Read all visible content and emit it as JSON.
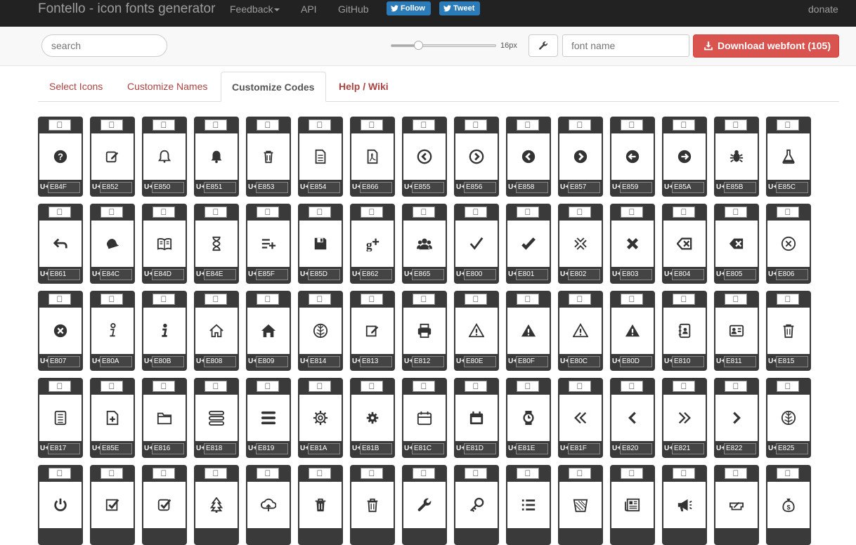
{
  "navbar": {
    "brand": "Fontello - icon fonts generator",
    "links": [
      "Feedback",
      "API",
      "GitHub"
    ],
    "follow": "Follow",
    "tweet": "Tweet",
    "donate": "donate"
  },
  "toolbar": {
    "search_placeholder": "search",
    "size_label": "16px",
    "size_slider_value_fraction": 0.25,
    "fontname_placeholder": "font name",
    "download_label": "Download webfont (105)"
  },
  "tabs": [
    "Select Icons",
    "Customize Names",
    "Customize Codes",
    "Help / Wiki"
  ],
  "active_tab": "Customize Codes",
  "glyph_prefix": "U+",
  "glyphs": [
    {
      "char": "",
      "code": "E84F",
      "icon": "help-circle"
    },
    {
      "char": "",
      "code": "E852",
      "icon": "edit"
    },
    {
      "char": "",
      "code": "E850",
      "icon": "bell-outline"
    },
    {
      "char": "",
      "code": "E851",
      "icon": "bell"
    },
    {
      "char": "",
      "code": "E853",
      "icon": "trash"
    },
    {
      "char": "",
      "code": "E854",
      "icon": "doc-text"
    },
    {
      "char": "",
      "code": "E866",
      "icon": "file-pdf"
    },
    {
      "char": "",
      "code": "E855",
      "icon": "left-circle-outline"
    },
    {
      "char": "",
      "code": "E856",
      "icon": "right-circle-outline"
    },
    {
      "char": "",
      "code": "E858",
      "icon": "left-circle"
    },
    {
      "char": "",
      "code": "E857",
      "icon": "right-circle"
    },
    {
      "char": "",
      "code": "E859",
      "icon": "left-circle-arrow"
    },
    {
      "char": "",
      "code": "E85A",
      "icon": "right-circle-arrow"
    },
    {
      "char": "",
      "code": "E85B",
      "icon": "bug"
    },
    {
      "char": "",
      "code": "E85C",
      "icon": "beaker"
    },
    {
      "char": "",
      "code": "E861",
      "icon": "reply"
    },
    {
      "char": "",
      "code": "E84C",
      "icon": "bell-tilt"
    },
    {
      "char": "",
      "code": "E84D",
      "icon": "book-open"
    },
    {
      "char": "",
      "code": "E84E",
      "icon": "hourglass"
    },
    {
      "char": "",
      "code": "E85F",
      "icon": "list-add"
    },
    {
      "char": "",
      "code": "E85D",
      "icon": "floppy"
    },
    {
      "char": "",
      "code": "E862",
      "icon": "gplus"
    },
    {
      "char": "",
      "code": "E865",
      "icon": "users"
    },
    {
      "char": "",
      "code": "E800",
      "icon": "check-thin"
    },
    {
      "char": "",
      "code": "E801",
      "icon": "check"
    },
    {
      "char": "",
      "code": "E802",
      "icon": "cancel-outline"
    },
    {
      "char": "",
      "code": "E803",
      "icon": "cancel"
    },
    {
      "char": "",
      "code": "E804",
      "icon": "backspace-outline"
    },
    {
      "char": "",
      "code": "E805",
      "icon": "backspace"
    },
    {
      "char": "",
      "code": "E806",
      "icon": "cancel-circle-outline"
    },
    {
      "char": "",
      "code": "E807",
      "icon": "cancel-circle"
    },
    {
      "char": "",
      "code": "E80A",
      "icon": "info-outline"
    },
    {
      "char": "",
      "code": "E80B",
      "icon": "info"
    },
    {
      "char": "",
      "code": "E808",
      "icon": "home-outline"
    },
    {
      "char": "",
      "code": "E809",
      "icon": "home"
    },
    {
      "char": "",
      "code": "E814",
      "icon": "leaf-circle"
    },
    {
      "char": "",
      "code": "E813",
      "icon": "edit-square"
    },
    {
      "char": "",
      "code": "E812",
      "icon": "print"
    },
    {
      "char": "",
      "code": "E80E",
      "icon": "attention-outline"
    },
    {
      "char": "",
      "code": "E80F",
      "icon": "attention"
    },
    {
      "char": "",
      "code": "E80C",
      "icon": "attention-outline-2"
    },
    {
      "char": "",
      "code": "E80D",
      "icon": "attention-2"
    },
    {
      "char": "",
      "code": "E810",
      "icon": "address-book"
    },
    {
      "char": "",
      "code": "E811",
      "icon": "id-card"
    },
    {
      "char": "",
      "code": "E815",
      "icon": "trash-2"
    },
    {
      "char": "",
      "code": "E817",
      "icon": "doc-lines"
    },
    {
      "char": "",
      "code": "E85E",
      "icon": "doc-add"
    },
    {
      "char": "",
      "code": "E816",
      "icon": "folder"
    },
    {
      "char": "",
      "code": "E818",
      "icon": "menu-outline"
    },
    {
      "char": "",
      "code": "E819",
      "icon": "menu"
    },
    {
      "char": "",
      "code": "E81A",
      "icon": "cog-outline"
    },
    {
      "char": "",
      "code": "E81B",
      "icon": "cog"
    },
    {
      "char": "",
      "code": "E81C",
      "icon": "calendar-outline"
    },
    {
      "char": "",
      "code": "E81D",
      "icon": "calendar"
    },
    {
      "char": "",
      "code": "E81E",
      "icon": "watch"
    },
    {
      "char": "",
      "code": "E81F",
      "icon": "angle-double-left"
    },
    {
      "char": "",
      "code": "E820",
      "icon": "angle-left"
    },
    {
      "char": "",
      "code": "E821",
      "icon": "angle-double-right"
    },
    {
      "char": "",
      "code": "E822",
      "icon": "angle-right"
    },
    {
      "char": "",
      "code": "E825",
      "icon": "leaf-circle-2"
    },
    {
      "char": "",
      "code": "",
      "icon": "power"
    },
    {
      "char": "",
      "code": "",
      "icon": "check-square"
    },
    {
      "char": "",
      "code": "",
      "icon": "check-square-2"
    },
    {
      "char": "",
      "code": "",
      "icon": "tree"
    },
    {
      "char": "",
      "code": "",
      "icon": "cloud-upload"
    },
    {
      "char": "",
      "code": "",
      "icon": "bin"
    },
    {
      "char": "",
      "code": "",
      "icon": "bin-2"
    },
    {
      "char": "",
      "code": "",
      "icon": "wrench"
    },
    {
      "char": "",
      "code": "",
      "icon": "key"
    },
    {
      "char": "",
      "code": "",
      "icon": "list"
    },
    {
      "char": "",
      "code": "",
      "icon": "basket"
    },
    {
      "char": "",
      "code": "",
      "icon": "newspaper"
    },
    {
      "char": "",
      "code": "",
      "icon": "megaphone"
    },
    {
      "char": "",
      "code": "",
      "icon": "ticket"
    },
    {
      "char": "",
      "code": "",
      "icon": "money-bag"
    }
  ]
}
